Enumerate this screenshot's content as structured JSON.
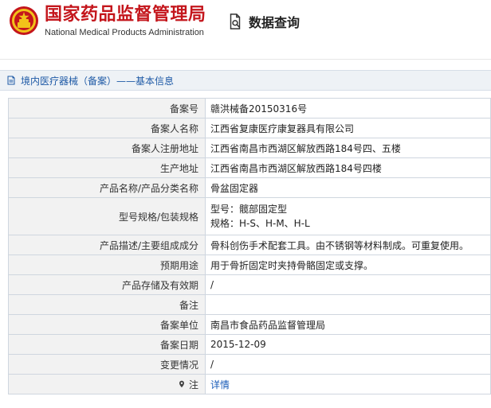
{
  "header": {
    "brand_zh": "国家药品监督管理局",
    "brand_en": "National Medical Products Administration",
    "query_title": "数据查询"
  },
  "breadcrumb": {
    "text": "境内医疗器械（备案）——基本信息"
  },
  "record": {
    "rows": [
      {
        "label": "备案号",
        "value": "赣洪械备20150316号"
      },
      {
        "label": "备案人名称",
        "value": "江西省复康医疗康复器具有限公司"
      },
      {
        "label": "备案人注册地址",
        "value": "江西省南昌市西湖区解放西路184号四、五楼"
      },
      {
        "label": "生产地址",
        "value": "江西省南昌市西湖区解放西路184号四楼"
      },
      {
        "label": "产品名称/产品分类名称",
        "value": "骨盆固定器"
      },
      {
        "label": "型号规格/包装规格",
        "value_lines": [
          "型号：髋部固定型",
          "规格：H-S、H-M、H-L"
        ]
      },
      {
        "label": "产品描述/主要组成成分",
        "value": "骨科创伤手术配套工具。由不锈钢等材料制成。可重复使用。"
      },
      {
        "label": "预期用途",
        "value": "用于骨折固定时夹持骨骼固定或支撑。"
      },
      {
        "label": "产品存储及有效期",
        "value": "/"
      },
      {
        "label": "备注",
        "value": ""
      },
      {
        "label": "备案单位",
        "value": "南昌市食品药品监督管理局"
      },
      {
        "label": "备案日期",
        "value": "2015-12-09"
      },
      {
        "label": "变更情况",
        "value": "/"
      },
      {
        "label": "注",
        "value": "详情"
      }
    ]
  },
  "icons": {
    "emblem": "national-emblem-icon",
    "query": "search-doc-icon",
    "breadcrumb": "document-icon",
    "note": "pin-icon"
  },
  "colors": {
    "brand_red": "#c4161c",
    "link_blue": "#1a5cb8"
  }
}
